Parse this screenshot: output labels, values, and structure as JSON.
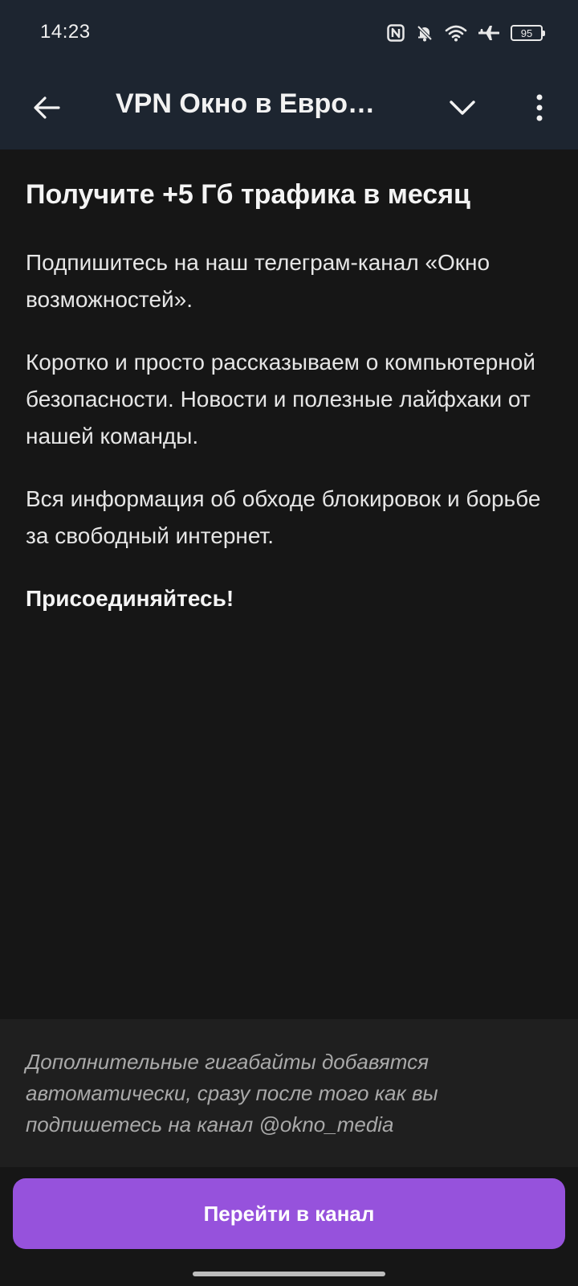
{
  "status_bar": {
    "time": "14:23",
    "battery_level": "95",
    "icons": [
      "nfc-icon",
      "bell-off-icon",
      "wifi-icon",
      "airplane-icon",
      "battery-icon"
    ]
  },
  "app_bar": {
    "title": "VPN Окно в Евро…",
    "back_icon": "arrow-left-icon",
    "dropdown_icon": "chevron-down-icon",
    "more_icon": "more-vertical-icon"
  },
  "content": {
    "headline": "Получите +5 Гб трафика в месяц",
    "paragraph_1": "Подпишитесь на наш телеграм-канал «Окно возможностей».",
    "paragraph_2": "Коротко и просто рассказываем о компьютерной безопасности. Новости и полезные лайфхаки от нашей команды.",
    "paragraph_3": "Вся информация об обходе блокировок и борьбе за свободный интернет.",
    "paragraph_4": "Присоединяйтесь!"
  },
  "note": {
    "text": "Дополнительные гигабайты добавятся автоматически, сразу после того как вы подпишетесь на канал @okno_media"
  },
  "cta": {
    "label": "Перейти в канал",
    "color": "#9652dc"
  },
  "colors": {
    "background": "#161616",
    "app_bar": "#1d2530",
    "note_panel": "#1f1f1f"
  }
}
